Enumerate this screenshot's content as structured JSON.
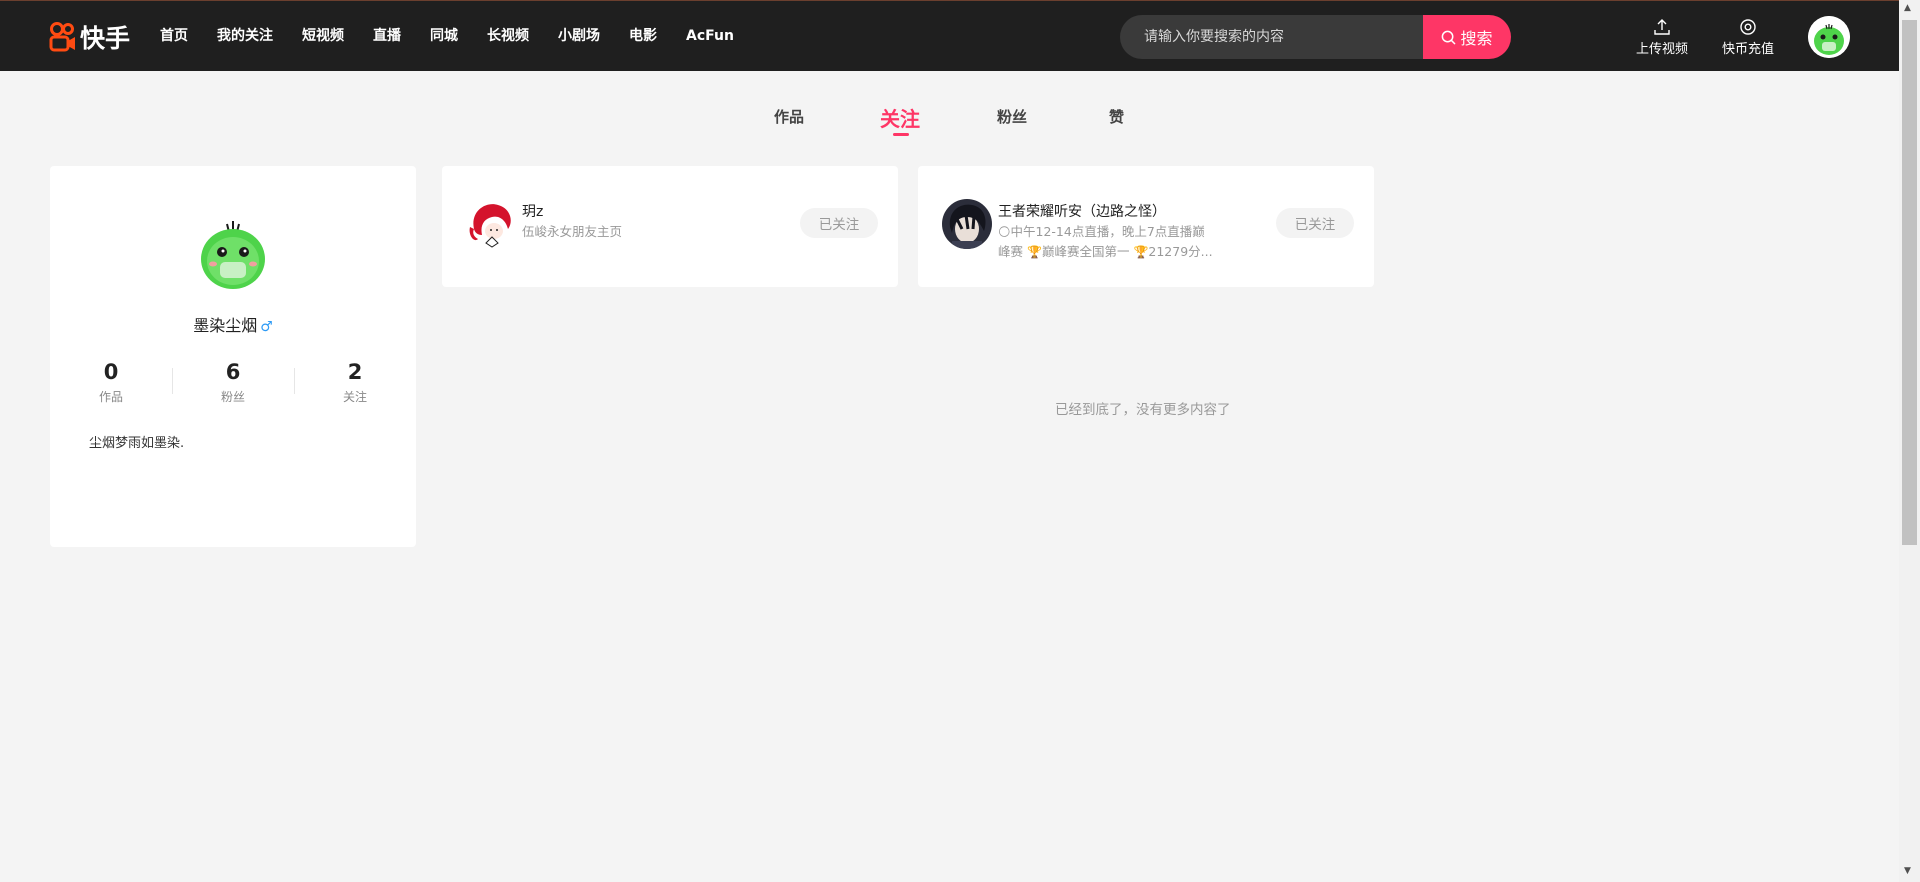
{
  "header": {
    "logo_text": "快手",
    "nav": [
      "首页",
      "我的关注",
      "短视频",
      "直播",
      "同城",
      "长视频",
      "小剧场",
      "电影",
      "AcFun"
    ],
    "search": {
      "placeholder": "请输入你要搜索的内容",
      "button_label": "搜索"
    },
    "upload_label": "上传视频",
    "recharge_label": "快币充值"
  },
  "tabs": [
    "作品",
    "关注",
    "粉丝",
    "赞"
  ],
  "active_tab": "关注",
  "profile": {
    "name": "墨染尘烟",
    "gender_symbol": "♂",
    "stats": [
      {
        "value": "0",
        "label": "作品"
      },
      {
        "value": "6",
        "label": "粉丝"
      },
      {
        "value": "2",
        "label": "关注"
      }
    ],
    "bio": "尘烟梦雨如墨染."
  },
  "following": [
    {
      "name": "玥z",
      "desc": "伍峻永女朋友主页",
      "button_label": "已关注"
    },
    {
      "name": "王者荣耀听安（边路之怪）",
      "desc_parts": [
        "中午12-14点直播，晚上7点直播巅峰赛",
        "巅峰赛全国第一",
        "21279分..."
      ],
      "button_label": "已关注"
    }
  ],
  "end_message": "已经到底了，没有更多内容了",
  "colors": {
    "accent": "#fe3666",
    "header_bg": "#1f1f1f",
    "page_bg": "#f4f4f4",
    "gender": "#2d9af5"
  }
}
